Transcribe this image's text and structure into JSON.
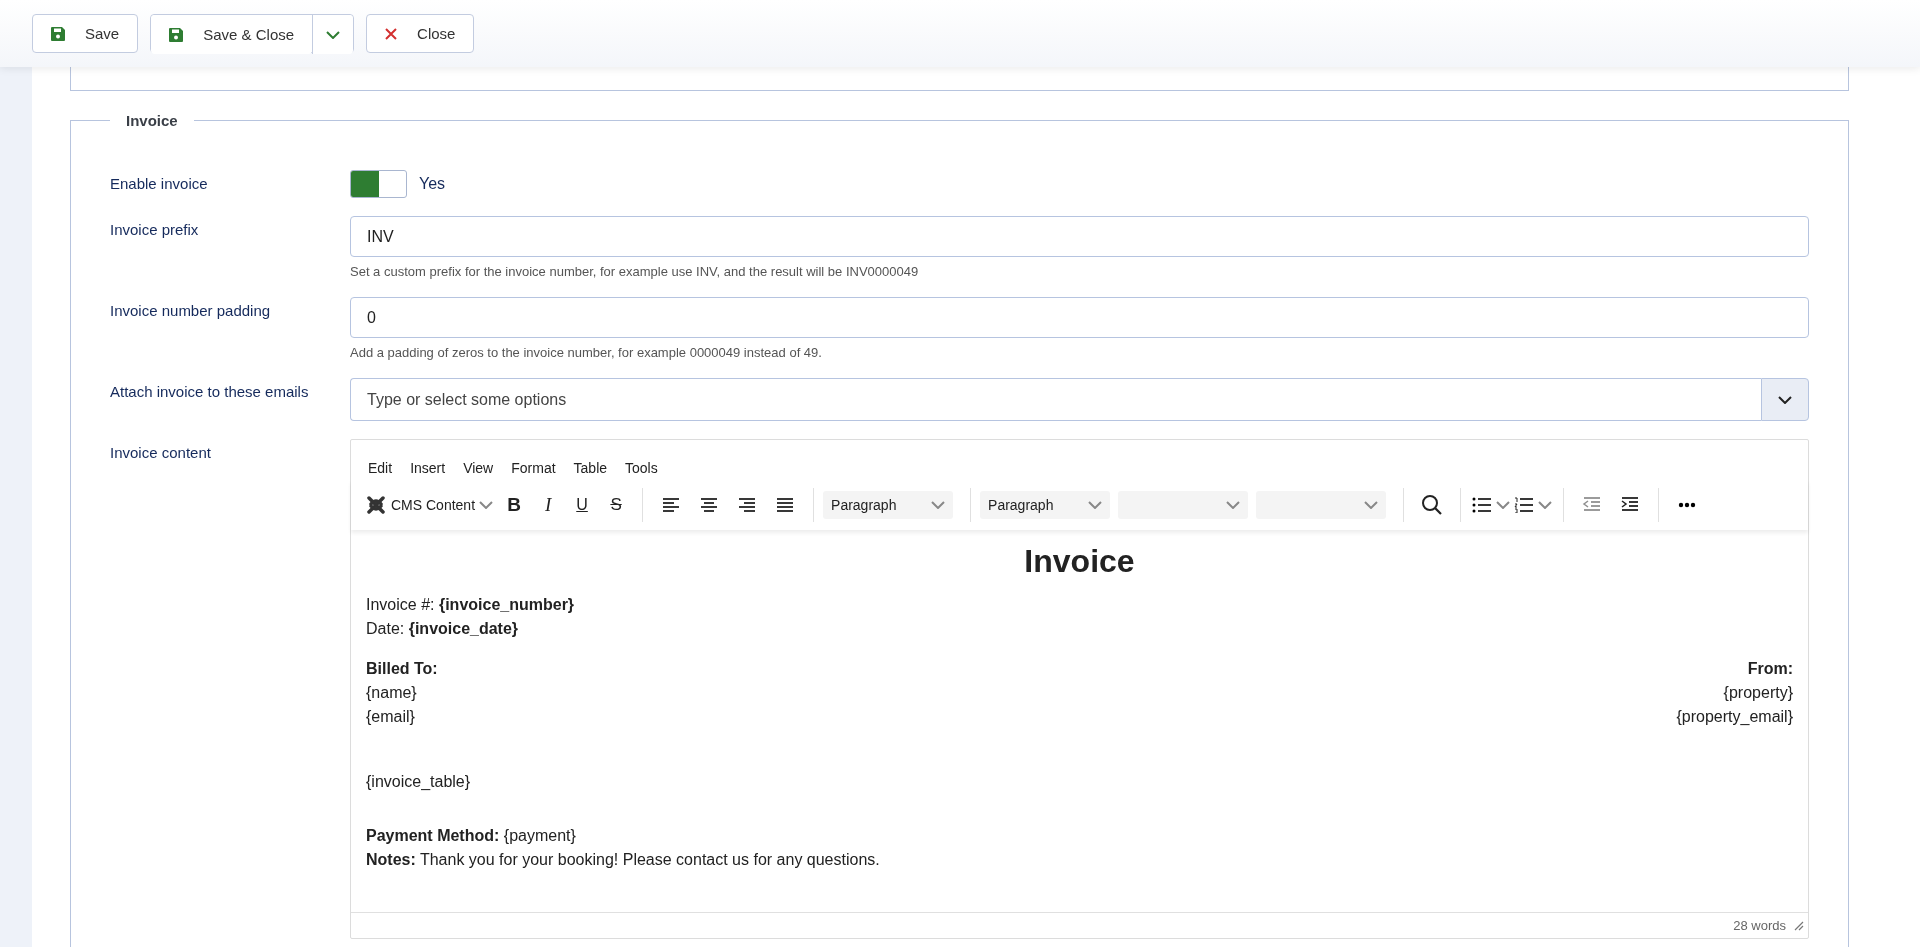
{
  "toolbar": {
    "buttons": [
      {
        "kind": "save",
        "label": "Save",
        "split": false
      },
      {
        "kind": "save",
        "label": "Save & Close",
        "split": true
      },
      {
        "kind": "close",
        "label": "Close",
        "split": false
      }
    ]
  },
  "fieldset": {
    "legend": "Invoice",
    "fields": [
      {
        "kind": "toggle",
        "label": "Enable invoice",
        "on": true,
        "value": "Yes"
      },
      {
        "kind": "text",
        "label": "Invoice prefix",
        "value": "INV",
        "hint": "Set a custom prefix for the invoice number, for example use INV, and the result will be INV0000049"
      },
      {
        "kind": "text",
        "label": "Invoice number padding",
        "value": "0",
        "hint": "Add a padding of zeros to the invoice number, for example 0000049 instead of 49."
      },
      {
        "kind": "multiselect",
        "label": "Attach invoice to these emails",
        "placeholder": "Type or select some options"
      },
      {
        "kind": "editor",
        "label": "Invoice content"
      }
    ]
  },
  "editor": {
    "menu": [
      "Edit",
      "Insert",
      "View",
      "Format",
      "Table",
      "Tools"
    ],
    "brand_label": "CMS Content",
    "format_buttons": [
      {
        "kind": "bold",
        "glyph": "B"
      },
      {
        "kind": "italic",
        "glyph": "I"
      },
      {
        "kind": "underline",
        "glyph": "U"
      },
      {
        "kind": "strike",
        "glyph": "S"
      }
    ],
    "selects": [
      "Paragraph",
      "Paragraph"
    ],
    "document": {
      "title": "Invoice",
      "meta": [
        "Invoice #: **{invoice_number}**",
        "Date: **{invoice_date}**"
      ],
      "billed_to": {
        "heading": "Billed To:",
        "lines": [
          "{name}",
          "{email}"
        ]
      },
      "from": {
        "heading": "From:",
        "lines": [
          "{property}",
          "{property_email}"
        ]
      },
      "table_placeholder": "{invoice_table}",
      "footer": [
        "**Payment Method:** {payment}",
        "**Notes:** Thank you for your booking! Please contact us for any questions."
      ]
    },
    "word_count": "28 words"
  }
}
